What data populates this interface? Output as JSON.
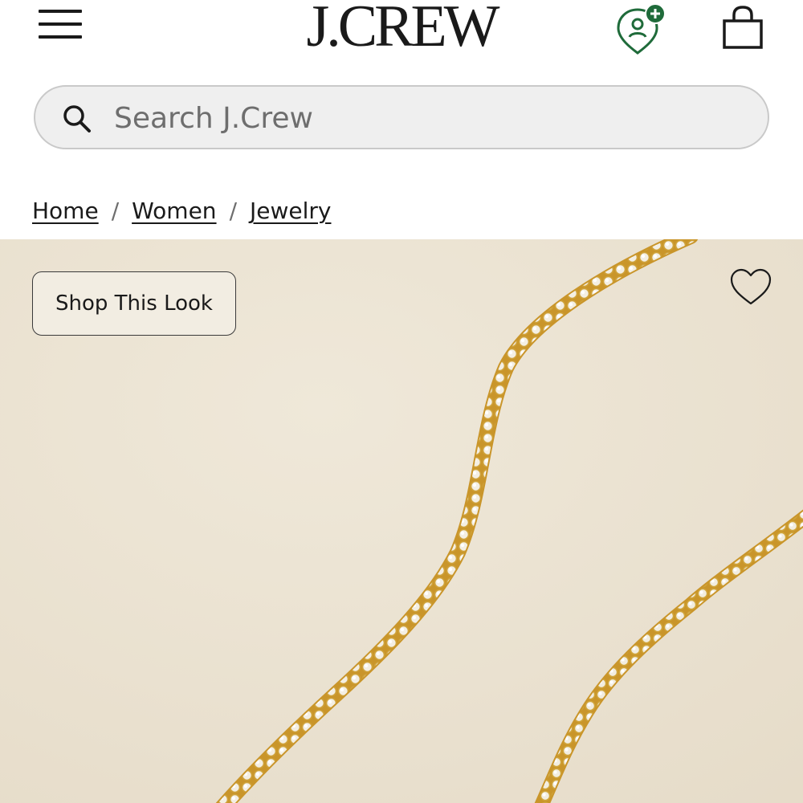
{
  "header": {
    "logo_text": "J.CREW",
    "menu_icon": "hamburger-menu-icon",
    "account_icon": "account-location-add-icon",
    "bag_icon": "shopping-bag-icon"
  },
  "search": {
    "placeholder": "Search J.Crew",
    "value": "",
    "icon": "search-icon"
  },
  "breadcrumb": {
    "items": [
      {
        "label": "Home"
      },
      {
        "label": "Women"
      },
      {
        "label": "Jewelry"
      }
    ],
    "separator": "/"
  },
  "hero": {
    "shop_look_label": "Shop This Look",
    "wishlist_icon": "heart-icon",
    "image_subject": "two gold tennis necklaces with clear stones"
  },
  "colors": {
    "text": "#1a1a1a",
    "search_bg": "#efefef",
    "hero_bg": "#ebe3d3",
    "accent_green": "#1f6b3a",
    "gold": "#d4a826"
  }
}
